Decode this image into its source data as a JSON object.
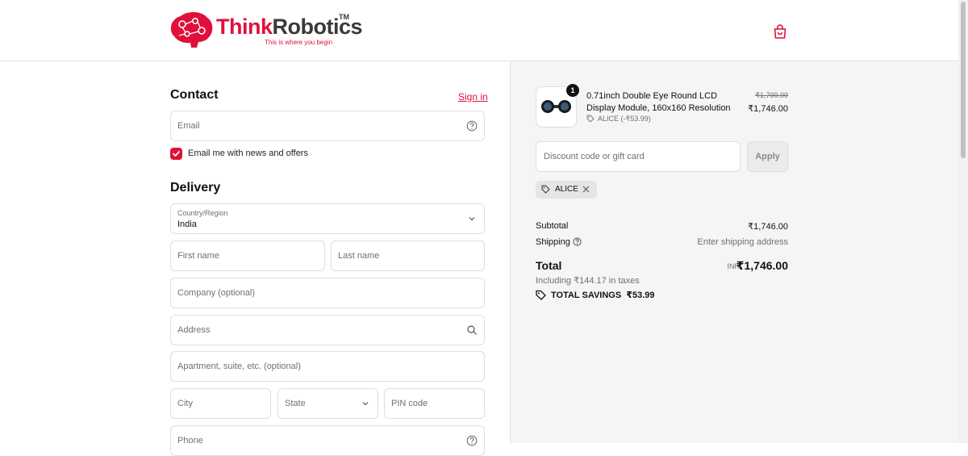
{
  "brand": {
    "name_part1": "Think",
    "name_part2": "Robotics",
    "trademark": "TM",
    "tagline": "This is where you begin"
  },
  "header": {
    "cart_icon": "shopping-bag-icon",
    "accent_color": "#e0103b"
  },
  "contact": {
    "title": "Contact",
    "sign_in": "Sign in",
    "email_placeholder": "Email",
    "newsletter_label": "Email me with news and offers",
    "newsletter_checked": true
  },
  "delivery": {
    "title": "Delivery",
    "country_label": "Country/Region",
    "country_value": "India",
    "first_name": "First name",
    "last_name": "Last name",
    "company": "Company (optional)",
    "address": "Address",
    "apartment": "Apartment, suite, etc. (optional)",
    "city": "City",
    "state": "State",
    "pin": "PIN code",
    "phone": "Phone"
  },
  "order": {
    "item": {
      "quantity": "1",
      "name": "0.71inch Double Eye Round LCD Display Module, 160x160 Resolution",
      "discount": "ALICE (-₹53.99)",
      "original_price": "₹1,799.99",
      "price": "₹1,746.00"
    },
    "discount_placeholder": "Discount code or gift card",
    "apply_label": "Apply",
    "applied_code": "ALICE",
    "subtotal_label": "Subtotal",
    "subtotal_value": "₹1,746.00",
    "shipping_label": "Shipping",
    "shipping_value": "Enter shipping address",
    "total_label": "Total",
    "currency": "INR",
    "total_value": "₹1,746.00",
    "tax_note": "Including ₹144.17 in taxes",
    "savings_label": "TOTAL SAVINGS",
    "savings_value": "₹53.99"
  }
}
